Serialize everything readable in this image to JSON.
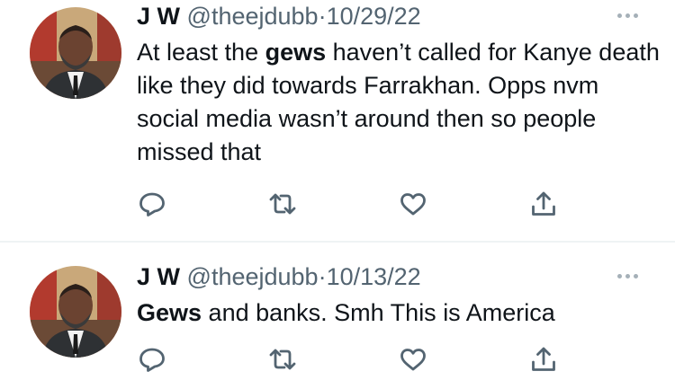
{
  "tweets": [
    {
      "name": "J W",
      "handle": "@theejdubb",
      "separator": "·",
      "date": "10/29/22",
      "body": [
        {
          "text": "At least the ",
          "bold": false
        },
        {
          "text": "gews",
          "bold": true
        },
        {
          "text": " haven’t called for Kanye death like they did towards Farrakhan. Opps nvm social media wasn’t around then so people missed that",
          "bold": false
        }
      ]
    },
    {
      "name": "J W",
      "handle": "@theejdubb",
      "separator": "·",
      "date": "10/13/22",
      "body": [
        {
          "text": "Gews",
          "bold": true
        },
        {
          "text": " and banks. Smh This is America",
          "bold": false
        }
      ]
    }
  ],
  "colors": {
    "text": "#0f1419",
    "secondary": "#536471",
    "icon": "#536471",
    "divider": "#eff3f4"
  },
  "icons": [
    "reply-icon",
    "retweet-icon",
    "like-icon",
    "share-icon",
    "more-icon"
  ]
}
